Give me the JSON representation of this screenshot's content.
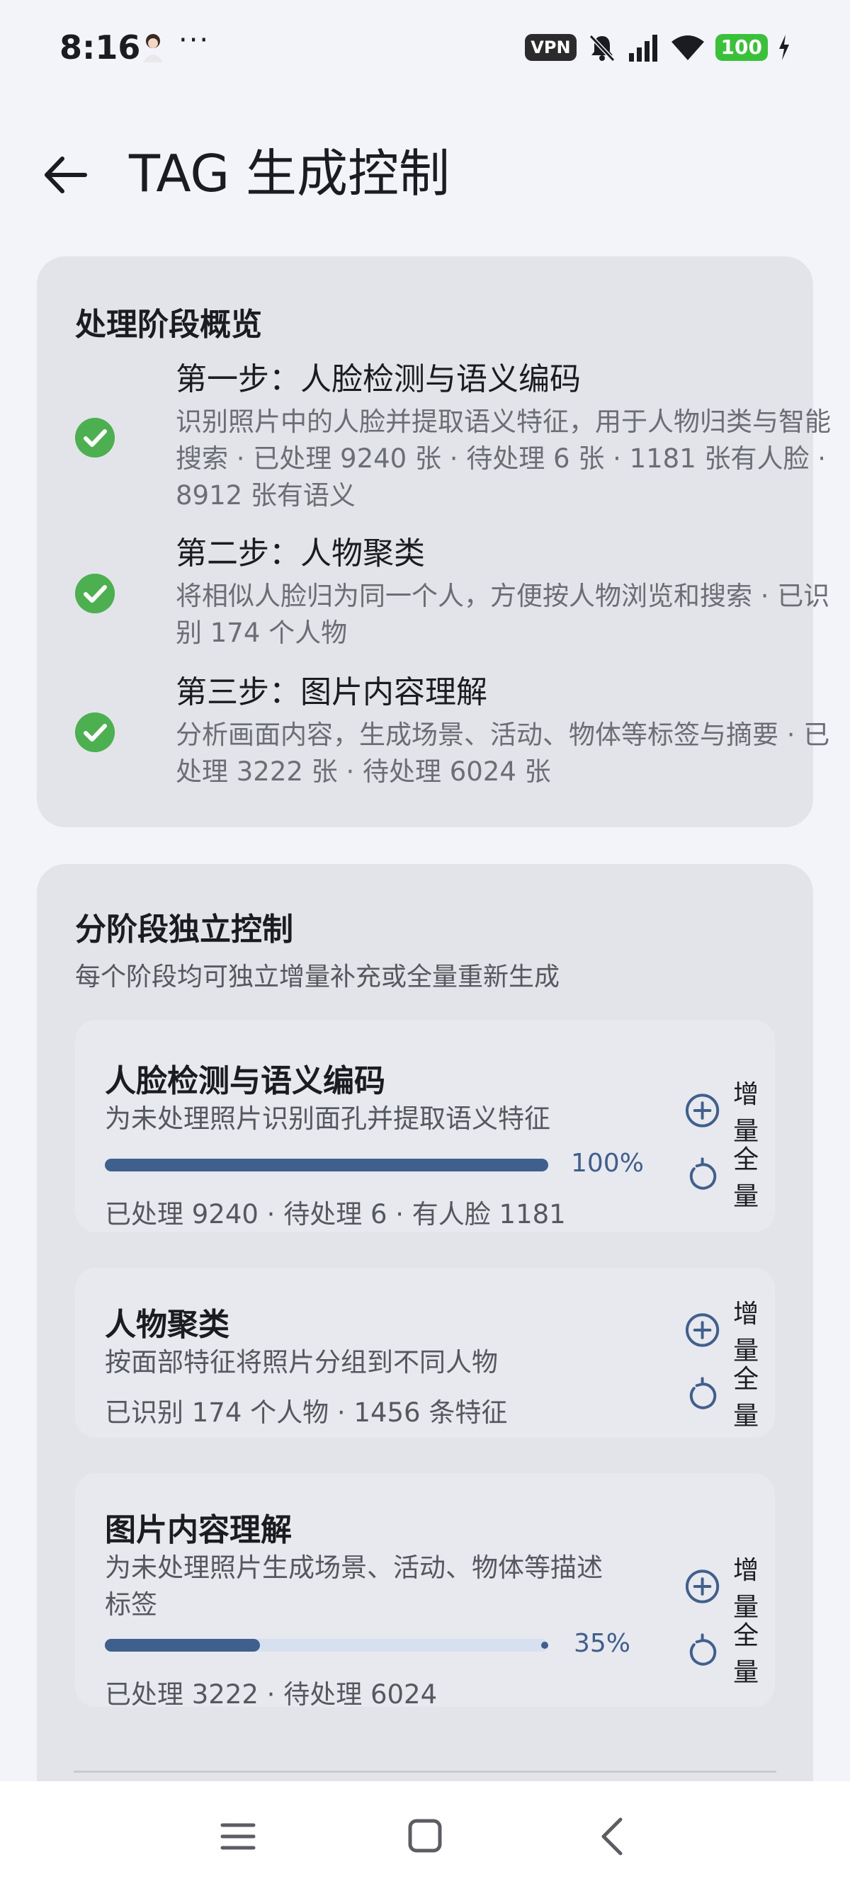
{
  "status": {
    "time": "8:16",
    "more": "···",
    "vpn": "VPN",
    "battery": "100"
  },
  "header": {
    "title": "TAG 生成控制"
  },
  "overview": {
    "title": "处理阶段概览",
    "steps": [
      {
        "title": "第一步：人脸检测与语义编码",
        "desc": "识别照片中的人脸并提取语义特征，用于人物归类与智能搜索 · 已处理 9240 张 · 待处理 6 张 · 1181 张有人脸 · 8912 张有语义",
        "status": "done"
      },
      {
        "title": "第二步：人物聚类",
        "desc": "将相似人脸归为同一个人，方便按人物浏览和搜索 · 已识别 174 个人物",
        "status": "done"
      },
      {
        "title": "第三步：图片内容理解",
        "desc": "分析画面内容，生成场景、活动、物体等标签与摘要 · 已处理 3222 张 · 待处理 6024 张",
        "status": "done"
      }
    ]
  },
  "control": {
    "title": "分阶段独立控制",
    "subtitle": "每个阶段均可独立增量补充或全量重新生成",
    "incremental_label": "增量",
    "full_label": "全量",
    "stages": [
      {
        "title": "人脸检测与语义编码",
        "desc": "为未处理照片识别面孔并提取语义特征",
        "progress": 1.0,
        "progress_text": "100%",
        "meta": "已处理 9240 · 待处理 6 · 有人脸 1181"
      },
      {
        "title": "人物聚类",
        "desc": "按面部特征将照片分组到不同人物",
        "meta": "已识别 174 个人物 · 1456 条特征"
      },
      {
        "title": "图片内容理解",
        "desc": "为未处理照片生成场景、活动、物体等描述标签",
        "progress": 0.35,
        "progress_text": "35%",
        "meta": "已处理 3222 · 待处理 6024"
      }
    ]
  },
  "colors": {
    "accent": "#3f5f8c",
    "check": "#4caf50",
    "card": "#e3e4ea",
    "background": "#f3f4f9"
  },
  "icons": [
    "back-arrow-icon",
    "check-circle-icon",
    "add-circle-icon",
    "refresh-icon",
    "menu-icon",
    "home-icon",
    "back-icon"
  ]
}
